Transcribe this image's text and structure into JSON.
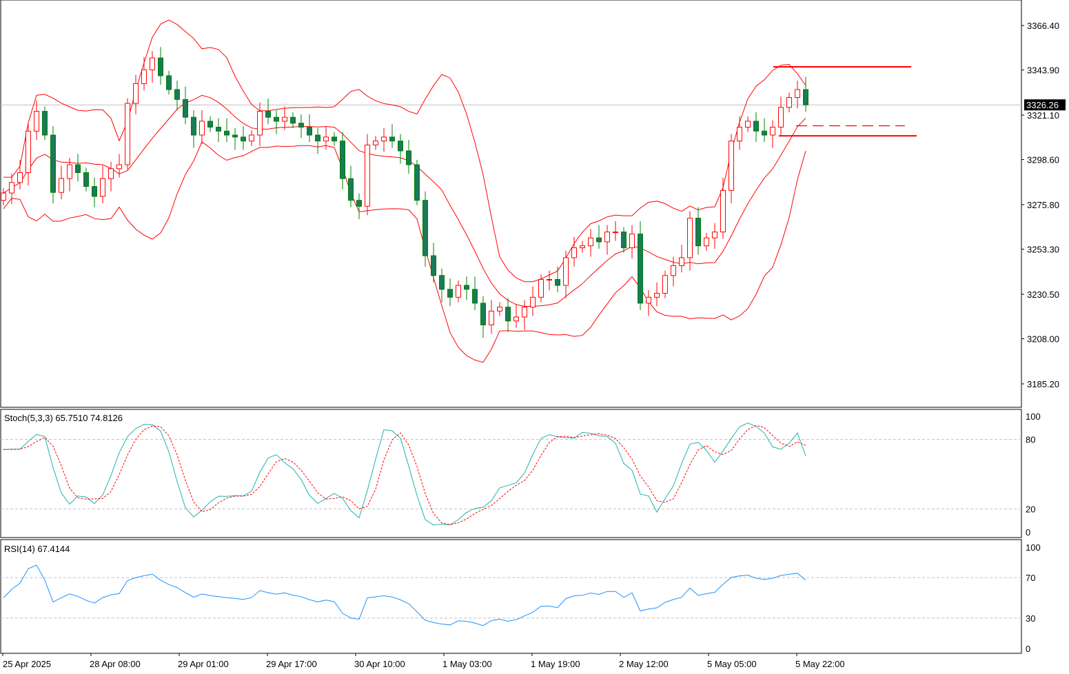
{
  "chart_data": {
    "type": "candlestick",
    "symbol_note": "",
    "price_axis": {
      "ticks": [
        "3366.40",
        "3343.90",
        "3321.10",
        "3298.60",
        "3275.80",
        "3253.30",
        "3230.50",
        "3208.00",
        "3185.20"
      ],
      "range": [
        3185.2,
        3366.4
      ]
    },
    "current_price": {
      "value": 3326.26,
      "label": "3326.26"
    },
    "time_axis": {
      "ticks": [
        "25 Apr 2025",
        "28 Apr 08:00",
        "29 Apr 01:00",
        "29 Apr 17:00",
        "30 Apr 10:00",
        "1 May 03:00",
        "1 May 19:00",
        "2 May 12:00",
        "5 May 05:00",
        "5 May 22:00"
      ]
    },
    "first_open": 3278,
    "close": [
      3281.7,
      3287,
      3292,
      3313,
      3323,
      3311,
      3282,
      3289,
      3296,
      3292,
      3285,
      3280,
      3289,
      3294,
      3296,
      3327,
      3337,
      3344,
      3350,
      3341,
      3334,
      3329,
      3320,
      3311,
      3318,
      3315,
      3313,
      3311,
      3310,
      3308,
      3311,
      3323,
      3320,
      3318,
      3320,
      3317,
      3315,
      3311,
      3308,
      3310,
      3308,
      3289,
      3278,
      3275,
      3306,
      3308,
      3310,
      3308,
      3303,
      3296,
      3278,
      3250,
      3240,
      3233,
      3229,
      3235,
      3233,
      3226,
      3215,
      3222,
      3224,
      3217,
      3219,
      3224,
      3229,
      3238,
      3238,
      3235,
      3249,
      3254,
      3255,
      3259,
      3257,
      3262,
      3262,
      3254,
      3261,
      3226,
      3229,
      3231,
      3240,
      3245,
      3249,
      3269,
      3255,
      3259,
      3262,
      3283,
      3308,
      3315,
      3318,
      3313,
      3311,
      3315,
      3325,
      3330,
      3334,
      3326.26
    ],
    "bollinger": {
      "color": "#ff0000"
    },
    "levels": [
      {
        "price": 3345.5,
        "style": "solid",
        "color": "#ff0000"
      },
      {
        "price": 3310.6,
        "style": "solid",
        "color": "#ff0000"
      },
      {
        "price": 3315.7,
        "style": "dashed",
        "color": "#ff0000"
      }
    ],
    "colors": {
      "bull": "#ff0000",
      "bear": "#008000",
      "bear_fill": "#1a7a5a"
    },
    "stochastic": {
      "label": "Stoch(5,3,3) 65.7510 74.8126",
      "main_value": 65.751,
      "signal_value": 74.8126,
      "levels": [
        "100",
        "80",
        "20",
        "0"
      ],
      "level_values": [
        100,
        80,
        20,
        0
      ],
      "main_color": "#20b2aa",
      "signal_color": "#ff0000"
    },
    "rsi": {
      "label": "RSI(14) 67.4144",
      "value": 67.4144,
      "levels": [
        "100",
        "70",
        "30",
        "0"
      ],
      "level_values": [
        100,
        70,
        30,
        0
      ],
      "color": "#1e90ff"
    }
  }
}
